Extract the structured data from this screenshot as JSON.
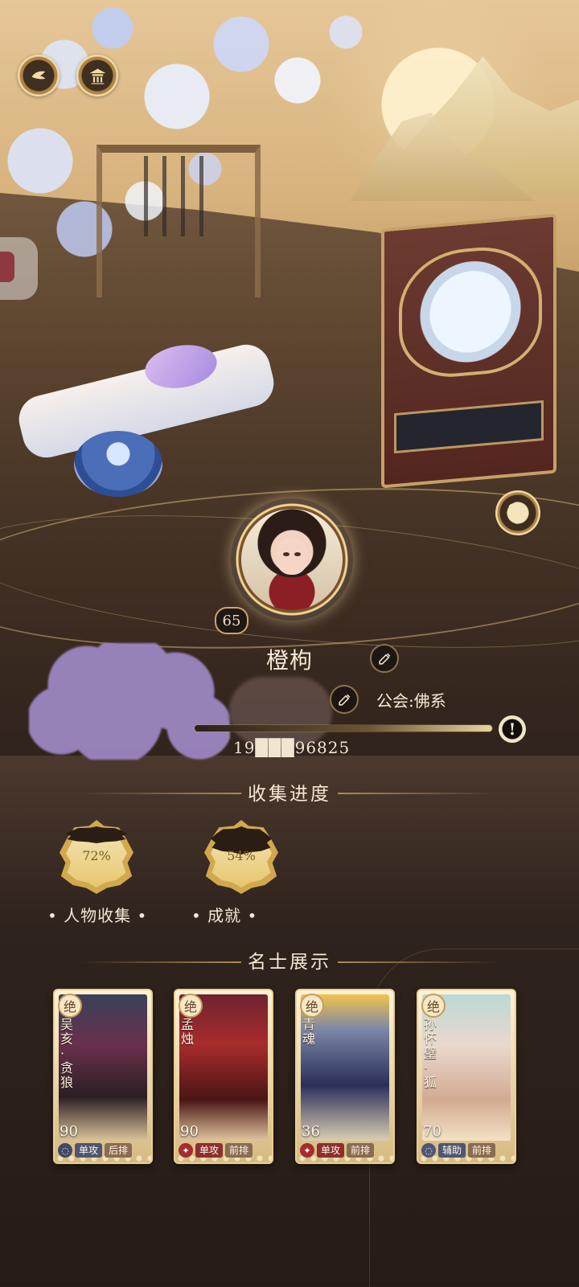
{
  "player": {
    "name": "橙枸",
    "level": "65",
    "guild": "公会:佛系",
    "id": "19███96825"
  },
  "sections": {
    "collection_title": "收集进度",
    "showcase_title": "名士展示"
  },
  "collection": [
    {
      "label": "人物收集",
      "percent": "72%",
      "value": 0.72
    },
    {
      "label": "成就",
      "percent": "54%",
      "value": 0.54
    }
  ],
  "cards": [
    {
      "rarity": "绝",
      "name": "吴亥 · 贪狼",
      "level": "90",
      "tag1": "单攻",
      "tag2": "后排",
      "icon": "shield-icon",
      "accent": "#3f4963"
    },
    {
      "rarity": "绝",
      "name": "孟烛",
      "level": "90",
      "tag1": "单攻",
      "tag2": "前排",
      "icon": "diamond-icon",
      "accent": "#a52d2d"
    },
    {
      "rarity": "绝",
      "name": "青魂",
      "level": "36",
      "tag1": "单攻",
      "tag2": "前排",
      "icon": "diamond-icon",
      "accent": "#2c3459"
    },
    {
      "rarity": "绝",
      "name": "孙怀璧 · 狐",
      "level": "70",
      "tag1": "辅助",
      "tag2": "前排",
      "icon": "shield-icon",
      "accent": "#8f7d8f"
    }
  ],
  "icons": {
    "top1": "bird-icon",
    "top2": "pavilion-icon",
    "settings": "gear-icon",
    "edit": "edit-icon",
    "exclaim": "exclamation-icon"
  },
  "colors": {
    "gold": "#d1a84d",
    "cream": "#f3e8d2",
    "dark": "#2a1f18",
    "blur": "#9d86c2"
  }
}
